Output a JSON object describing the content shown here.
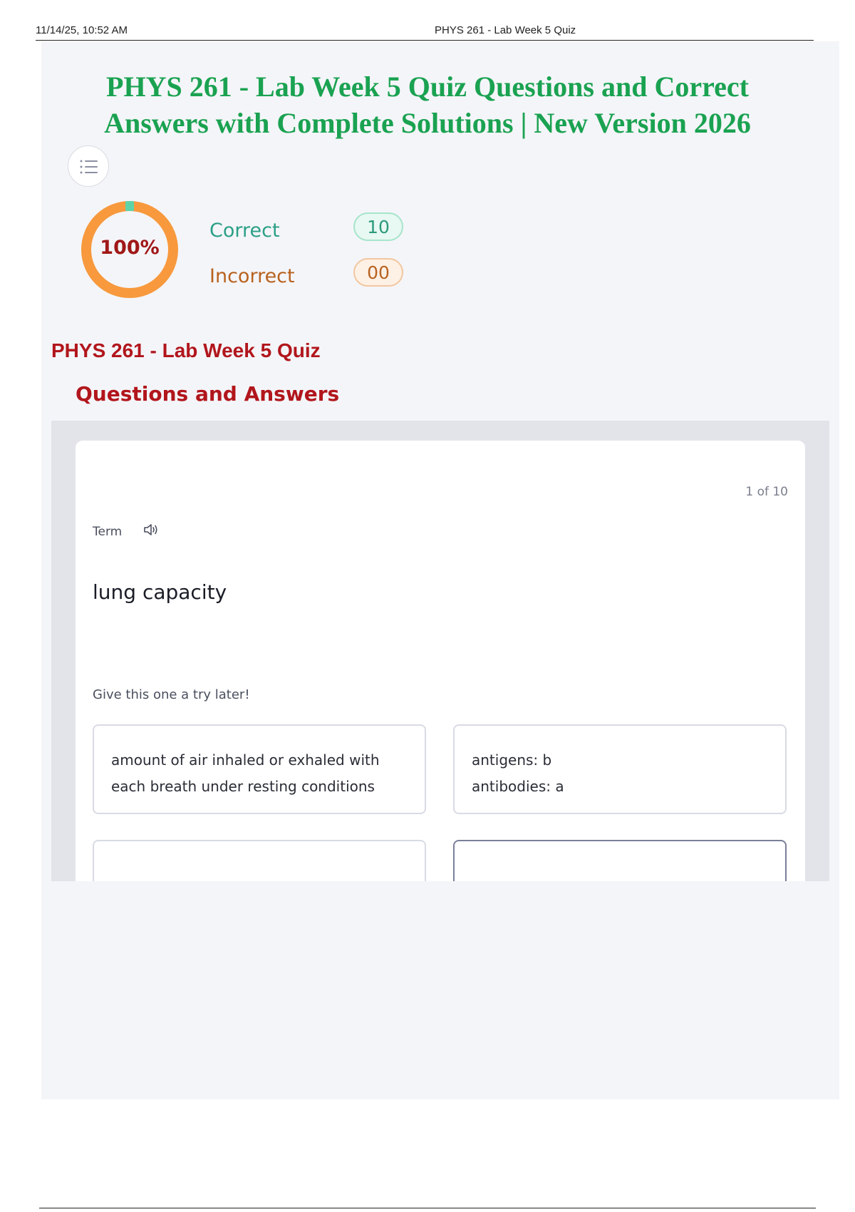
{
  "print_header": {
    "timestamp": "11/14/25, 10:52 AM",
    "title": "PHYS 261 - Lab Week 5 Quiz"
  },
  "document": {
    "title_line1": "PHYS 261 - Lab Week 5 Quiz Questions and Correct",
    "title_line2": "Answers with Complete Solutions | New Version 2026",
    "title_color": "#1aa251"
  },
  "menu": {
    "icon": "list-icon"
  },
  "score": {
    "percent_label": "100%",
    "percent": 100,
    "correct_label": "Correct",
    "correct_count": "10",
    "incorrect_label": "Incorrect",
    "incorrect_count": "00",
    "ring_color": "#f7993c",
    "correct_color": "#2aa086",
    "incorrect_color": "#b8621f"
  },
  "quiz": {
    "title": "PHYS 261 - Lab Week 5 Quiz",
    "subtitle": "Questions and Answers",
    "accent_color": "#b1161c"
  },
  "card": {
    "counter": "1 of 10",
    "term_label": "Term",
    "audio_icon": "speaker-icon",
    "term": "lung capacity",
    "hint": "Give this one a try later!",
    "options": [
      {
        "lines": [
          "amount of air inhaled or exhaled with",
          "each breath under resting conditions"
        ]
      },
      {
        "lines": [
          "antigens: b",
          "antibodies: a"
        ]
      },
      {
        "lines": []
      },
      {
        "lines": []
      }
    ]
  }
}
